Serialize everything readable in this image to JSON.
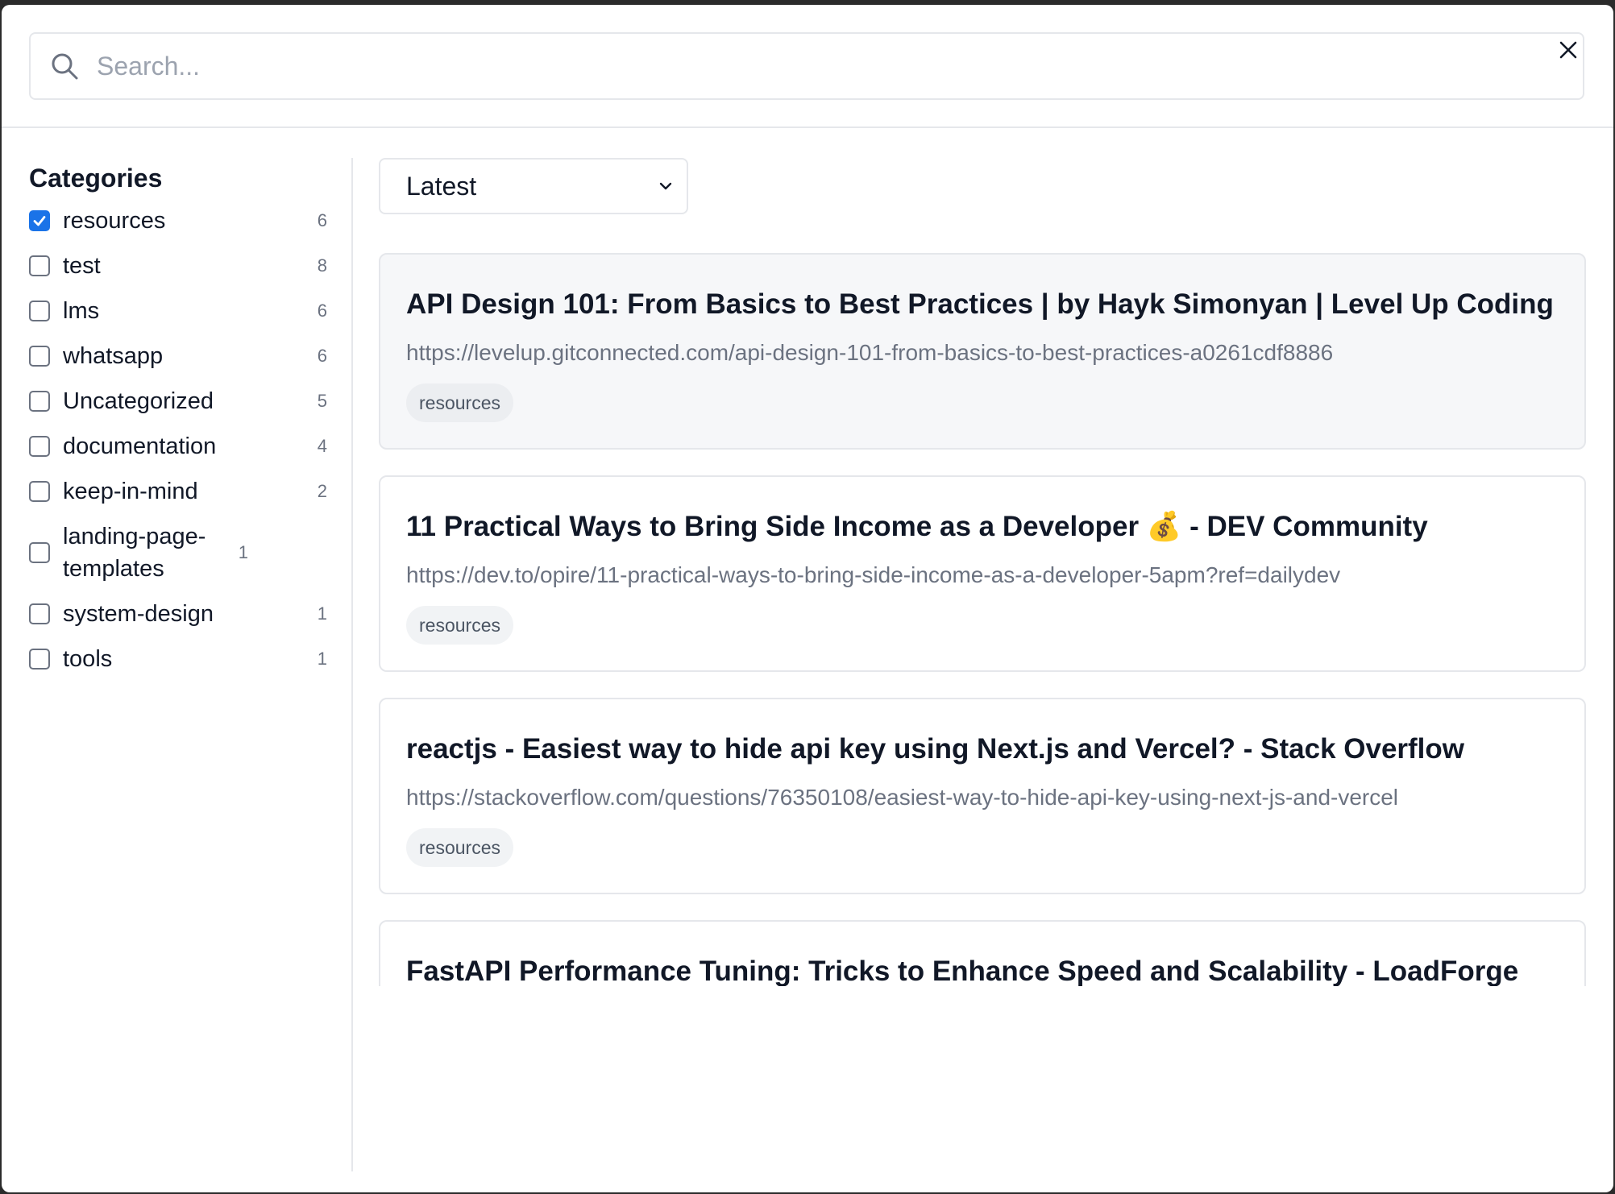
{
  "search": {
    "placeholder": "Search..."
  },
  "sidebar": {
    "title": "Categories",
    "categories": [
      {
        "label": "resources",
        "count": "6",
        "checked": true
      },
      {
        "label": "test",
        "count": "8",
        "checked": false
      },
      {
        "label": "lms",
        "count": "6",
        "checked": false
      },
      {
        "label": "whatsapp",
        "count": "6",
        "checked": false
      },
      {
        "label": "Uncategorized",
        "count": "5",
        "checked": false
      },
      {
        "label": "documentation",
        "count": "4",
        "checked": false
      },
      {
        "label": "keep-in-mind",
        "count": "2",
        "checked": false
      },
      {
        "label": "landing-page-templates",
        "count": "1",
        "checked": false
      },
      {
        "label": "system-design",
        "count": "1",
        "checked": false
      },
      {
        "label": "tools",
        "count": "1",
        "checked": false
      }
    ]
  },
  "sort": {
    "selected": "Latest"
  },
  "results": [
    {
      "title": "API Design 101: From Basics to Best Practices | by Hayk Simonyan | Level Up Coding",
      "url": "https://levelup.gitconnected.com/api-design-101-from-basics-to-best-practices-a0261cdf8886",
      "tag": "resources"
    },
    {
      "title": "11 Practical Ways to Bring Side Income as a Developer 💰 - DEV Community",
      "url": "https://dev.to/opire/11-practical-ways-to-bring-side-income-as-a-developer-5apm?ref=dailydev",
      "tag": "resources"
    },
    {
      "title": "reactjs - Easiest way to hide api key using Next.js and Vercel? - Stack Overflow",
      "url": "https://stackoverflow.com/questions/76350108/easiest-way-to-hide-api-key-using-next-js-and-vercel",
      "tag": "resources"
    },
    {
      "title": "FastAPI Performance Tuning: Tricks to Enhance Speed and Scalability - LoadForge",
      "url": "",
      "tag": ""
    }
  ],
  "colors": {
    "checkbox_checked": "#1a73e8",
    "muted_text": "#6b7280",
    "border": "#e5e7eb"
  }
}
